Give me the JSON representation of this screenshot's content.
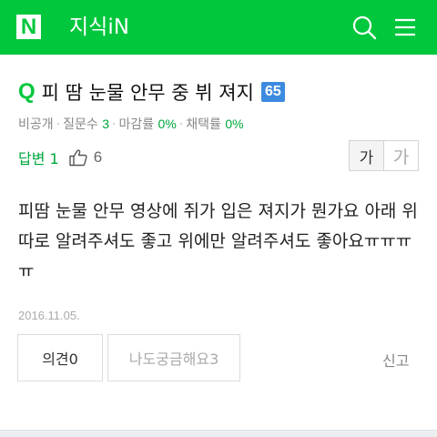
{
  "header": {
    "logo": "N",
    "service_title": "지식iN",
    "search_icon": "search-icon",
    "menu_icon": "hamburger-menu-icon",
    "color": "#00c73c"
  },
  "question": {
    "mark": "Q",
    "title": "피 땀 눈물 안무 중 뷔 져지",
    "badge": "65",
    "meta": {
      "privacy": "비공개",
      "question_count_label": "질문수",
      "question_count": "3",
      "deadline_rate_label": "마감률",
      "deadline_rate": "0%",
      "adoption_rate_label": "채택률",
      "adoption_rate": "0%"
    },
    "answer_count_label": "답변 1",
    "like_count": "6",
    "body": "피땀 눈물 안무 영상에 쥐가 입은 져지가 뭔가요 아래 위 따로 알려주셔도 좋고 위에만 알려주셔도 좋아요ㅠㅠㅠㅠ",
    "date": "2016.11.05."
  },
  "font_size_toggle": {
    "small": "가",
    "large": "가"
  },
  "actions": {
    "opinion": "의견0",
    "curious": "나도궁금해요3",
    "report": "신고"
  },
  "colors": {
    "accent": "#00c73c",
    "badge": "#3d8be0",
    "green_text": "#00a63c"
  }
}
